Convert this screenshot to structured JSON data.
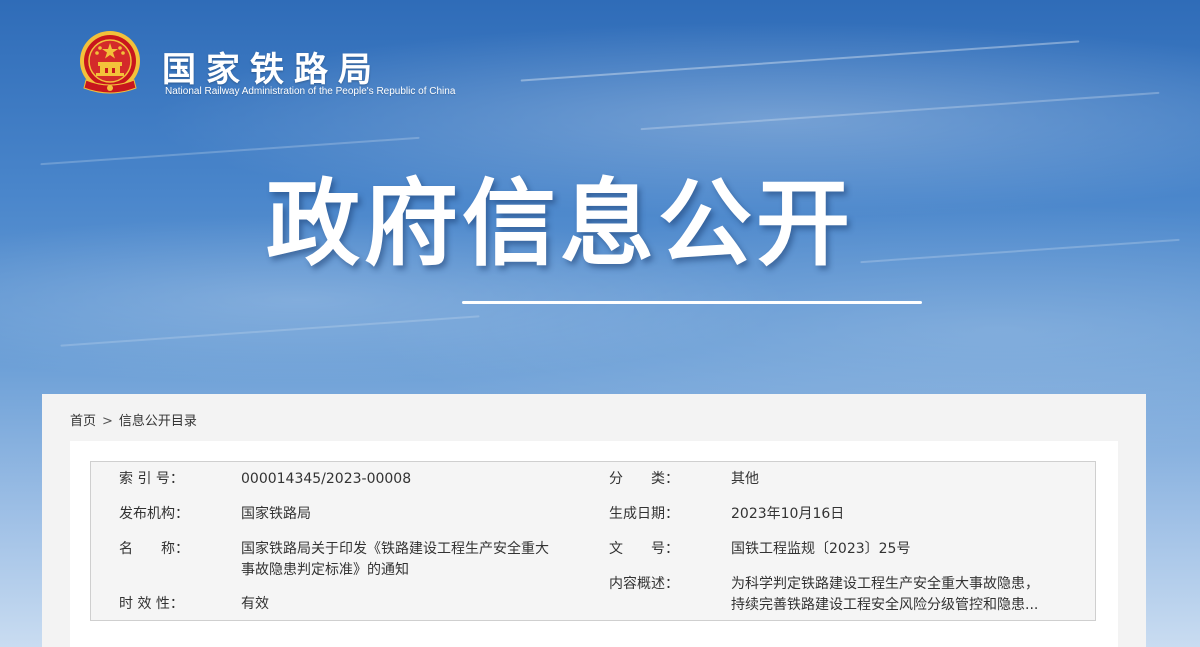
{
  "header": {
    "site_name": "国家铁路局",
    "site_name_en": "National Railway Administration of the People's Republic of China",
    "emblem_icon": "national-emblem-icon"
  },
  "hero": {
    "title": "政府信息公开"
  },
  "breadcrumb": {
    "home": "首页",
    "separator": ">",
    "current": "信息公开目录"
  },
  "info": {
    "index_label": "索 引 号：",
    "index_value": "000014345/2023-00008",
    "category_label": "分　　类：",
    "category_value": "其他",
    "issuer_label": "发布机构：",
    "issuer_value": "国家铁路局",
    "date_label": "生成日期：",
    "date_value": "2023年10月16日",
    "name_label": "名　　称：",
    "name_value_line1": "国家铁路局关于印发《铁路建设工程生产安全重大",
    "name_value_line2": "事故隐患判定标准》的通知",
    "doc_no_label": "文　　号：",
    "doc_no_value": "国铁工程监规〔2023〕25号",
    "summary_label": "内容概述：",
    "summary_line1": "为科学判定铁路建设工程生产安全重大事故隐患，",
    "summary_line2": "持续完善铁路建设工程安全风险分级管控和隐患...",
    "validity_label": "时 效 性：",
    "validity_value": "有效"
  },
  "colors": {
    "sky_top": "#2f6cb8",
    "sky_bottom": "#c9dcf1",
    "emblem_red": "#c8161d",
    "emblem_gold": "#f3c13a"
  }
}
